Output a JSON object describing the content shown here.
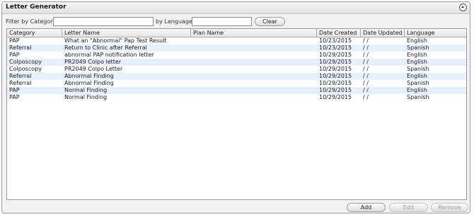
{
  "window": {
    "title": "Letter Generator"
  },
  "filters": {
    "category_label": "Filter by Category:",
    "category_value": "",
    "language_label": "by Language:",
    "language_value": "",
    "clear_label": "Clear"
  },
  "table": {
    "columns": [
      "Category",
      "Letter Name",
      "Plan Name",
      "Date Created",
      "Date Updated",
      "Language"
    ],
    "rows": [
      [
        "PAP",
        "What an \"Abnormal\" Pap Test Result",
        "",
        "10/23/2015",
        " / /",
        "English"
      ],
      [
        "Referral",
        "Return to Clinic after Referral",
        "",
        "10/23/2015",
        " / /",
        "Spanish"
      ],
      [
        "PAP",
        "abnormal PAP notification letter",
        "",
        "10/29/2015",
        " / /",
        "English"
      ],
      [
        "Colposcopy",
        "PR2049 Colpo letter",
        "",
        "10/29/2015",
        " / /",
        "English"
      ],
      [
        "Colposcopy",
        "PR2049 Colpo Letter",
        "",
        "10/29/2015",
        " / /",
        "Spanish"
      ],
      [
        "Referral",
        "Abnormal Finding",
        "",
        "10/29/2015",
        " / /",
        "English"
      ],
      [
        "Referral",
        "Abnormal Finding",
        "",
        "10/29/2015",
        " / /",
        "Spanish"
      ],
      [
        "PAP",
        "Normal Finding",
        "",
        "10/29/2015",
        " / /",
        "English"
      ],
      [
        "PAP",
        "Normal Finding",
        "",
        "10/29/2015",
        " / /",
        "Spanish"
      ]
    ]
  },
  "actions": {
    "add_label": "Add",
    "edit_label": "Edit",
    "remove_label": "Remove"
  },
  "icons": {
    "collapse": "collapse-up-icon"
  },
  "colors": {
    "row_alt": "#e8f1fb",
    "panel_bg": "#f2f2f2",
    "border": "#9aa0a6"
  }
}
